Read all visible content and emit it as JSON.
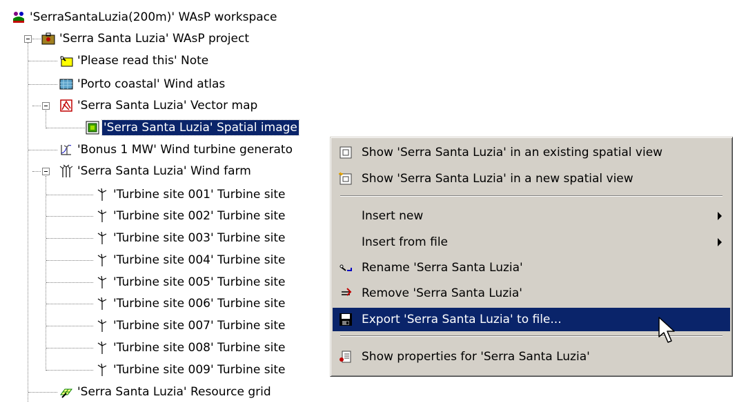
{
  "tree": {
    "workspace": "'SerraSantaLuzia(200m)' WAsP workspace",
    "project": "'Serra Santa Luzia' WAsP project",
    "note": "'Please read this' Note",
    "wind_atlas": "'Porto coastal' Wind atlas",
    "vector_map": "'Serra Santa Luzia' Vector map",
    "spatial_image": "'Serra Santa Luzia' Spatial image",
    "turbine_generator": "'Bonus 1 MW' Wind turbine generato",
    "wind_farm": "'Serra Santa Luzia' Wind farm",
    "turbine_sites": [
      "'Turbine site 001' Turbine site",
      "'Turbine site 002' Turbine site",
      "'Turbine site 003' Turbine site",
      "'Turbine site 004' Turbine site",
      "'Turbine site 005' Turbine site",
      "'Turbine site 006' Turbine site",
      "'Turbine site 007' Turbine site",
      "'Turbine site 008' Turbine site",
      "'Turbine site 009' Turbine site"
    ],
    "resource_grid": "'Serra Santa Luzia' Resource grid"
  },
  "context_menu": {
    "show_existing": "Show 'Serra Santa Luzia' in an existing spatial view",
    "show_new": "Show 'Serra Santa Luzia' in a new spatial view",
    "insert_new": "Insert new",
    "insert_from_file": "Insert from file",
    "rename": "Rename 'Serra Santa Luzia'",
    "remove": "Remove 'Serra Santa Luzia'",
    "export": "Export 'Serra Santa Luzia' to file...",
    "show_properties": "Show properties for 'Serra Santa Luzia'"
  },
  "colors": {
    "selection": "#0a246a",
    "menu_bg": "#d4d0c8"
  }
}
